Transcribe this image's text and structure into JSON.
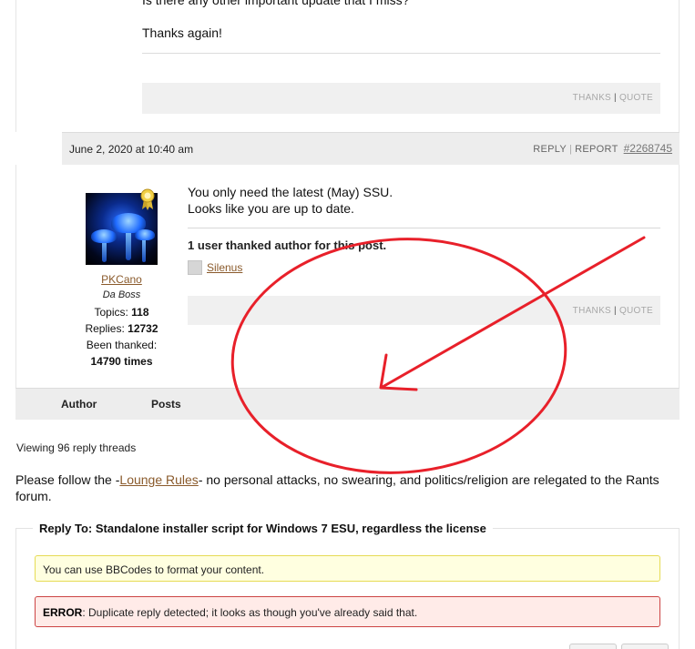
{
  "previous_post": {
    "line1": "Is there any other important update that I miss?",
    "line2": "Thanks again!",
    "actions": {
      "thanks": "THANKS",
      "quote": "QUOTE"
    }
  },
  "reply": {
    "date": "June 2, 2020 at 10:40 am",
    "links": {
      "reply": "REPLY",
      "report": "REPORT",
      "post_id": "#2268745"
    },
    "author": {
      "name": "PKCano",
      "role": "Da Boss",
      "topics_label": "Topics:",
      "topics": "118",
      "replies_label": "Replies:",
      "replies": "12732",
      "thanked_label": "Been thanked:",
      "thanked": "14790 times"
    },
    "message": [
      "You only need the latest (May) SSU.",
      "Looks like you are up to date."
    ],
    "thanked_heading": "1 user thanked author for this post.",
    "thanker": "Silenus",
    "actions": {
      "thanks": "THANKS",
      "quote": "QUOTE"
    }
  },
  "footer": {
    "author": "Author",
    "posts": "Posts"
  },
  "viewing": "Viewing 96 reply threads",
  "rules": {
    "prefix": "Please follow the -",
    "link": "Lounge Rules",
    "suffix": "- no personal attacks, no swearing, and politics/religion are relegated to the Rants forum."
  },
  "form": {
    "legend": "Reply To: Standalone installer script for Windows 7 ESU, regardless the license",
    "notice": "You can use BBCodes to format your content.",
    "error_label": "ERROR",
    "error_text": ": Duplicate reply detected; it looks as though you've already said that."
  },
  "colors": {
    "annotation": "#e8202a",
    "link": "#8a5a2b",
    "notice_bg": "#ffffe0",
    "error_bg": "#ffebe8"
  }
}
